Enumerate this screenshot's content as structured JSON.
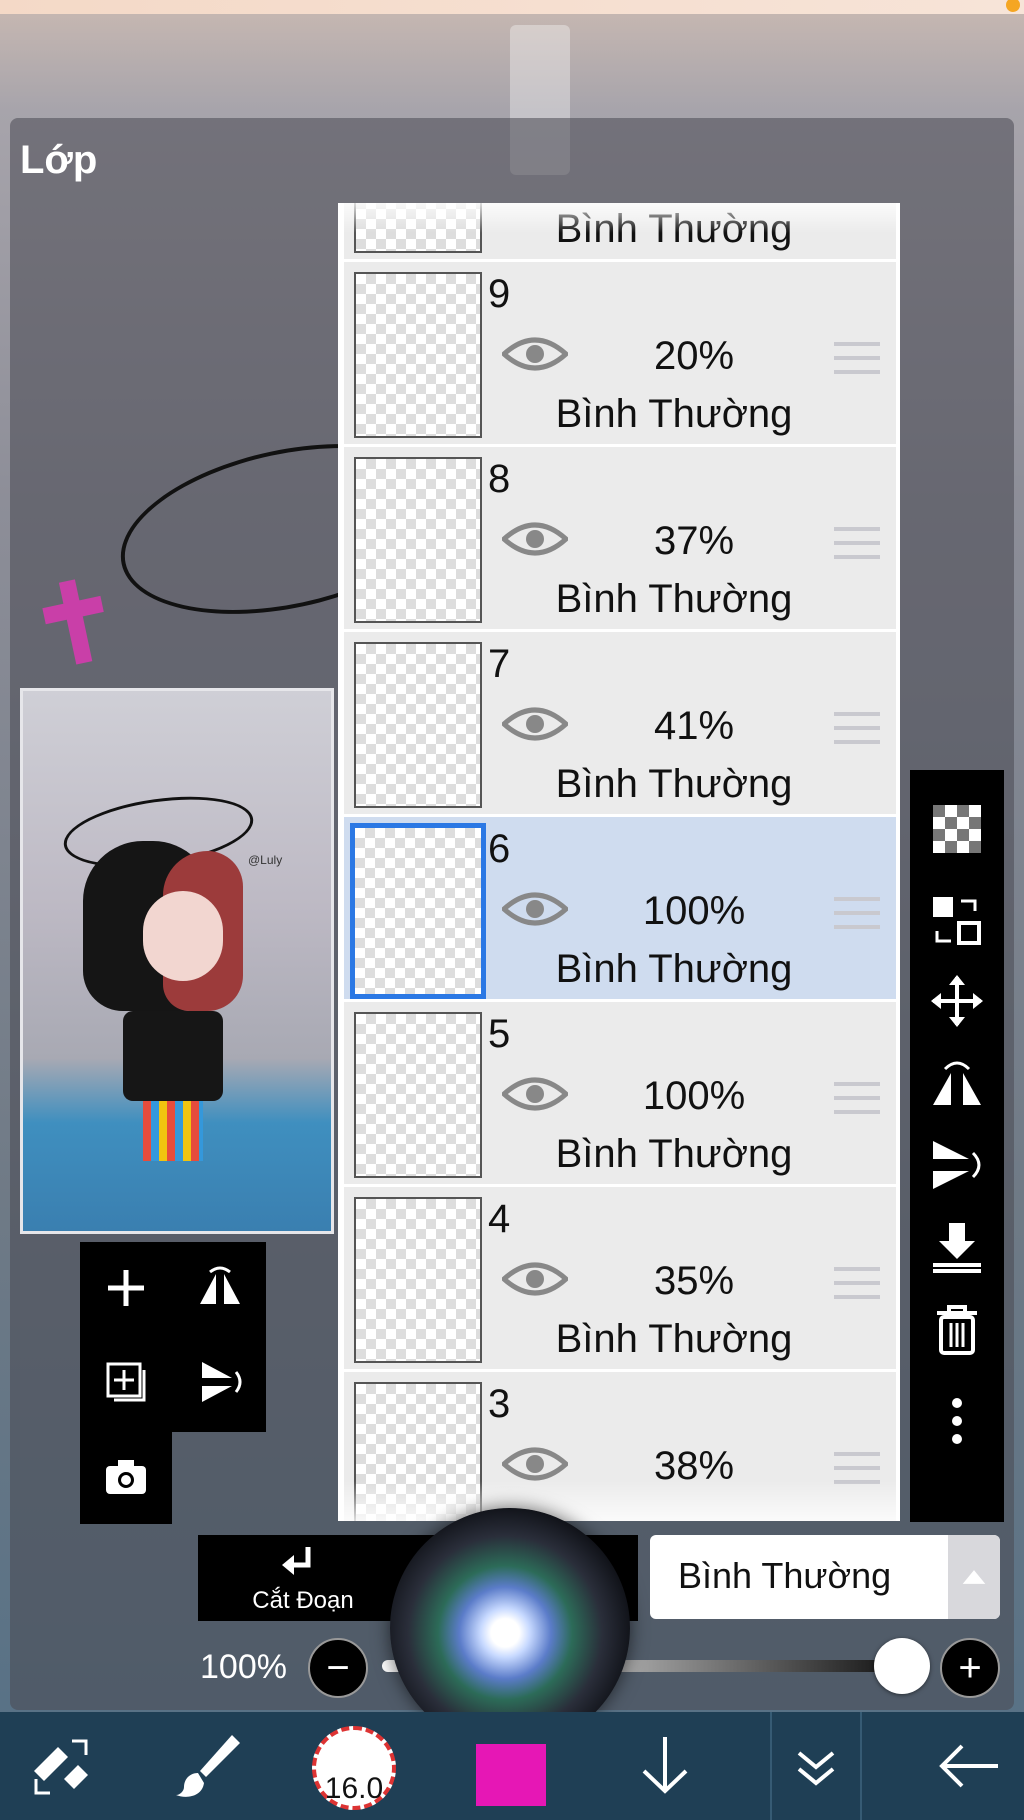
{
  "panel": {
    "title": "Lớp"
  },
  "layers": [
    {
      "name": "",
      "opacity": "",
      "mode": "Bình Thường",
      "selected": false
    },
    {
      "name": "9",
      "opacity": "20%",
      "mode": "Bình Thường",
      "selected": false
    },
    {
      "name": "8",
      "opacity": "37%",
      "mode": "Bình Thường",
      "selected": false
    },
    {
      "name": "7",
      "opacity": "41%",
      "mode": "Bình Thường",
      "selected": false
    },
    {
      "name": "6",
      "opacity": "100%",
      "mode": "Bình Thường",
      "selected": true
    },
    {
      "name": "5",
      "opacity": "100%",
      "mode": "Bình Thường",
      "selected": false
    },
    {
      "name": "4",
      "opacity": "35%",
      "mode": "Bình Thường",
      "selected": false
    },
    {
      "name": "3",
      "opacity": "38%",
      "mode": "",
      "selected": false
    }
  ],
  "preview": {
    "watermark": "@Luly"
  },
  "bottom": {
    "clip_label": "Cắt Đoạn",
    "blend_mode": "Bình Thường",
    "opacity_label": "100%",
    "opacity_value": 1.0,
    "minus": "−",
    "plus": "+"
  },
  "toolbar": {
    "brush_size": "16.0",
    "color": "#e617b5"
  },
  "colors": {
    "selected_layer": "#cfdcef",
    "selected_border": "#2b78e4",
    "accent_magenta": "#e617b5",
    "bottom_bar": "#1f3f55"
  },
  "icons": {
    "right_toolbar": [
      "transparent-bg-icon",
      "swap-layers-icon",
      "move-icon",
      "flip-horizontal-icon",
      "flip-vertical-icon",
      "merge-down-icon",
      "trash-icon",
      "more-icon"
    ],
    "mini_toolbar": [
      "add-layer-icon",
      "flip-horizontal-icon",
      "add-image-layer-icon",
      "flip-vertical-icon",
      "camera-icon"
    ],
    "bottom_toolbar": [
      "transform-eraser-icon",
      "brush-icon",
      "brush-size",
      "color-swatch",
      "move-down-icon",
      "double-chevron-icon",
      "back-arrow-icon"
    ]
  }
}
